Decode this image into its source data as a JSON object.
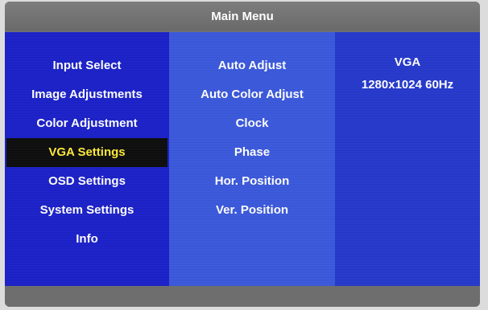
{
  "title": "Main Menu",
  "main_menu": {
    "items": [
      {
        "label": "Input Select"
      },
      {
        "label": "Image Adjustments"
      },
      {
        "label": "Color Adjustment"
      },
      {
        "label": "VGA Settings"
      },
      {
        "label": "OSD Settings"
      },
      {
        "label": "System Settings"
      },
      {
        "label": "Info"
      }
    ],
    "selected_index": 3
  },
  "submenu": {
    "items": [
      {
        "label": "Auto Adjust"
      },
      {
        "label": "Auto Color Adjust"
      },
      {
        "label": "Clock"
      },
      {
        "label": "Phase"
      },
      {
        "label": "Hor. Position"
      },
      {
        "label": "Ver. Position"
      }
    ]
  },
  "signal_info": {
    "source": "VGA",
    "resolution": "1280x1024 60Hz"
  },
  "colors": {
    "left_panel": "#1a20c8",
    "middle_panel": "#3a58dc",
    "right_panel": "#2438cc",
    "highlight_bg": "#0c0c0c",
    "highlight_text": "#ffeb3b",
    "frame": "#6e6e6e"
  }
}
